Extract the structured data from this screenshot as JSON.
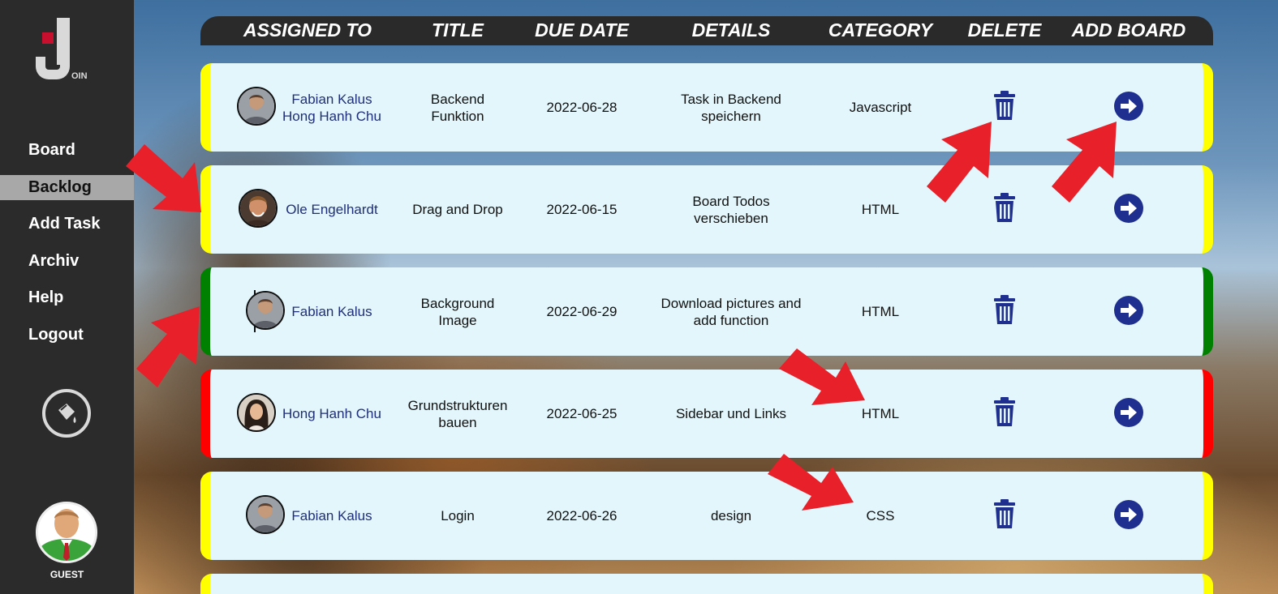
{
  "sidebar": {
    "logo_text": "OIN",
    "nav": [
      {
        "label": "Board"
      },
      {
        "label": "Backlog"
      },
      {
        "label": "Add Task"
      },
      {
        "label": "Archiv"
      },
      {
        "label": "Help"
      },
      {
        "label": "Logout"
      }
    ],
    "active_item": "Backlog",
    "user_label": "GUEST"
  },
  "header": {
    "columns": [
      "ASSIGNED TO",
      "TITLE",
      "DUE DATE",
      "DETAILS",
      "CATEGORY",
      "DELETE",
      "ADD BOARD"
    ]
  },
  "colors": {
    "urgency_yellow": "#ffff00",
    "urgency_green": "#008000",
    "urgency_red": "#ff0000",
    "html_category": "#f5a623",
    "css_category": "#1aa7e0",
    "icon_blue": "#1f2f8f",
    "annotation_arrow": "#e8202a"
  },
  "tasks": [
    {
      "assigned": [
        "Fabian Kalus",
        "Hong Hanh Chu"
      ],
      "title": "Backend Funktion",
      "due": "2022-06-28",
      "details": "Task in Backend speichern",
      "category": "Javascript",
      "urgency": "yellow"
    },
    {
      "assigned": [
        "Ole Engelhardt"
      ],
      "title": "Drag and Drop",
      "due": "2022-06-15",
      "details": "Board Todos verschieben",
      "category": "HTML",
      "urgency": "yellow"
    },
    {
      "assigned": [
        "Fabian Kalus"
      ],
      "title": "Background Image",
      "due": "2022-06-29",
      "details": "Download pictures and add function",
      "category": "HTML",
      "urgency": "green"
    },
    {
      "assigned": [
        "Hong Hanh Chu"
      ],
      "title": "Grundstrukturen bauen",
      "due": "2022-06-25",
      "details": "Sidebar und Links",
      "category": "HTML",
      "urgency": "red"
    },
    {
      "assigned": [
        "Fabian Kalus"
      ],
      "title": "Login",
      "due": "2022-06-26",
      "details": "design",
      "category": "CSS",
      "urgency": "yellow"
    }
  ]
}
